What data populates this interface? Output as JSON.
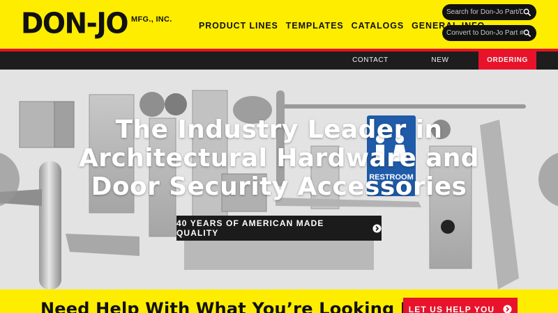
{
  "brand": {
    "name": "DON-JO",
    "suffix": "MFG., INC."
  },
  "nav": {
    "items": [
      "PRODUCT LINES",
      "TEMPLATES",
      "CATALOGS",
      "GENERAL INFO"
    ]
  },
  "search": {
    "part_placeholder": "Search for Don-Jo Part/Description",
    "convert_placeholder": "Convert to Don-Jo Part #"
  },
  "utility": {
    "contact": "CONTACT US",
    "new_products": "NEW PRODUCTS",
    "ordering": "ORDERING"
  },
  "hero": {
    "title": "The Industry Leader in Architectural Hardware and Door Security Accessories",
    "cta": "40 YEARS OF AMERICAN MADE QUALITY",
    "sign_text": "RESTROOM"
  },
  "help": {
    "text": "Need Help With What You’re Looking For?",
    "button": "LET US HELP YOU"
  },
  "colors": {
    "brand_yellow": "#ffed00",
    "accent_red": "#e8132b",
    "dark_bar": "#1d1d1d",
    "sign_blue": "#1f5ba8"
  }
}
